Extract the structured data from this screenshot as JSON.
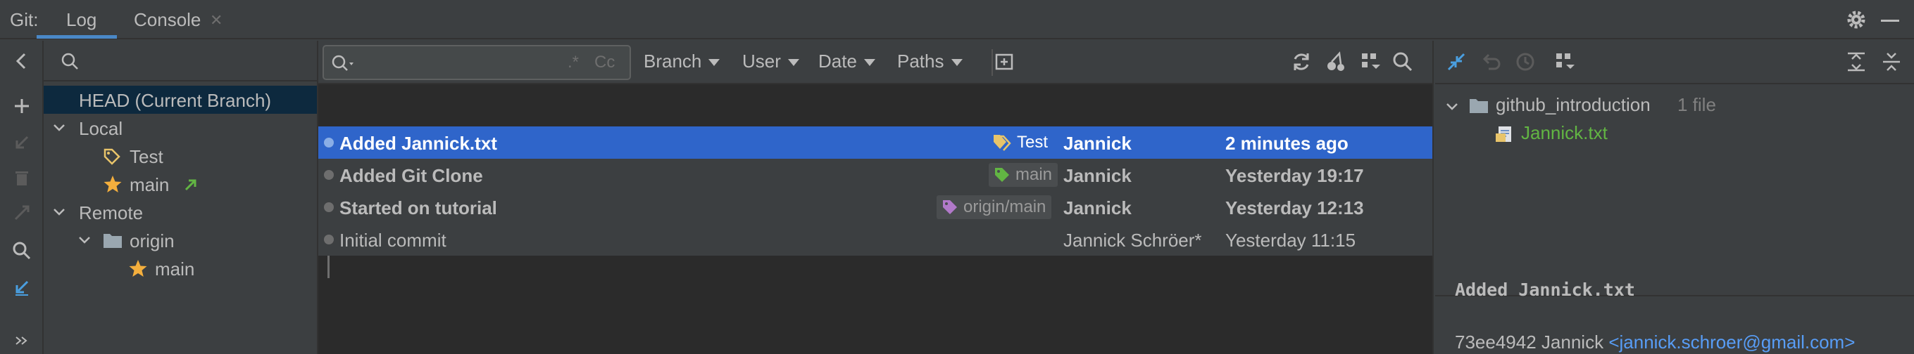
{
  "header": {
    "label": "Git:",
    "tabs": [
      {
        "label": "Log",
        "active": true
      },
      {
        "label": "Console",
        "closable": true
      }
    ],
    "close_glyph": "✕"
  },
  "branches": {
    "search_placeholder": "",
    "items": [
      {
        "label": "HEAD (Current Branch)",
        "selected": true
      },
      {
        "label": "Local"
      },
      {
        "label": "Test",
        "icon": "tag-icon"
      },
      {
        "label": "main",
        "icon": "star-icon",
        "indicator": "outgoing-arrow-icon"
      },
      {
        "label": "Remote"
      },
      {
        "label": "origin",
        "icon": "folder-icon"
      },
      {
        "label": "main",
        "icon": "star-icon"
      }
    ]
  },
  "log": {
    "search_placeholder": "",
    "regex_label": ".*",
    "case_label": "Cc",
    "filters": [
      "Branch",
      "User",
      "Date",
      "Paths"
    ],
    "commits": [
      {
        "subject": "Added Jannick.txt",
        "tag": "Test",
        "author": "Jannick",
        "date": "2 minutes ago",
        "selected": true,
        "bold": true
      },
      {
        "subject": "Added Git Clone",
        "tag": "main",
        "author": "Jannick",
        "date": "Yesterday 19:17",
        "bold": true
      },
      {
        "subject": "Started on tutorial",
        "tag": "origin/main",
        "author": "Jannick",
        "date": "Yesterday 12:13",
        "bold": true
      },
      {
        "subject": "Initial commit",
        "tag": "",
        "author": "Jannick Schröer*",
        "date": "Yesterday 11:15",
        "bold": false
      }
    ]
  },
  "details": {
    "folder": {
      "name": "github_introduction",
      "count": "1 file"
    },
    "file": "Jannick.txt",
    "message": "Added Jannick.txt",
    "hash": "73ee4942",
    "author": "Jannick",
    "email": "<jannick.schroer@gmail.com>"
  },
  "colors": {
    "accent": "#2f65ca",
    "tag_yellow": "#e8c46a",
    "tag_green": "#62b543",
    "tag_purple": "#b179c9",
    "star": "#f4af3d",
    "link": "#589df6"
  }
}
